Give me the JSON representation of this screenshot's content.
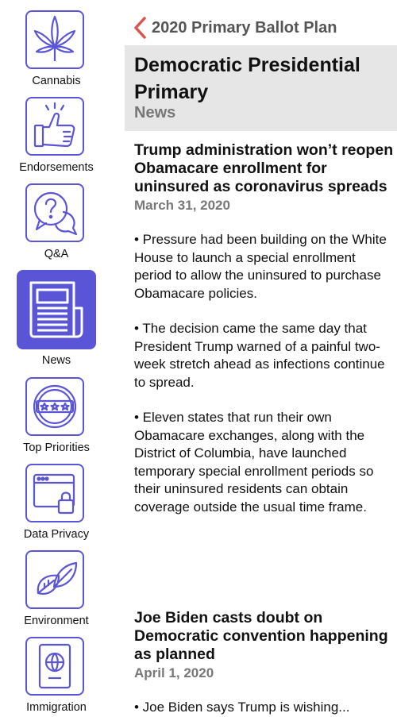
{
  "sidebar": {
    "items": [
      {
        "label": "Cannabis",
        "icon": "cannabis-leaf-icon"
      },
      {
        "label": "Endorsements",
        "icon": "thumbs-up-icon"
      },
      {
        "label": "Q&A",
        "icon": "question-bubbles-icon"
      },
      {
        "label": "News",
        "icon": "newspaper-icon",
        "active": true
      },
      {
        "label": "Top Priorities",
        "icon": "stars-badge-icon"
      },
      {
        "label": "Data Privacy",
        "icon": "browser-lock-icon"
      },
      {
        "label": "Environment",
        "icon": "leaves-icon"
      },
      {
        "label": "Immigration",
        "icon": "passport-icon"
      }
    ]
  },
  "nav": {
    "back_label": "2020 Primary Ballot Plan"
  },
  "header": {
    "title": "Democratic Presidential Primary",
    "subtitle": "News"
  },
  "articles": [
    {
      "title": "Trump administration won’t reopen Obamacare enrollment for uninsured as coronavirus spreads",
      "date": "March 31, 2020",
      "bullets": [
        "• Pressure had been building on the White House to launch a special enrollment period to allow the uninsured to purchase Obamacare policies.",
        "• The decision came the same day that President Trump warned of a painful two-week stretch ahead as infections continue to spread.",
        "• Eleven states that run their own Obamacare exchanges, along with the District of Columbia, have launched temporary special enrollment periods so their uninsured residents can obtain coverage outside the usual time frame."
      ]
    },
    {
      "title": "Joe Biden casts doubt on Democratic convention happening as planned",
      "date": "April 1, 2020",
      "bullets": [
        "• Joe Biden says Trump is wishing..."
      ]
    }
  ],
  "colors": {
    "accent": "#5a55d6",
    "back_chevron": "#d9534f",
    "header_bg": "#e6e6e6",
    "muted_text": "#777777"
  }
}
